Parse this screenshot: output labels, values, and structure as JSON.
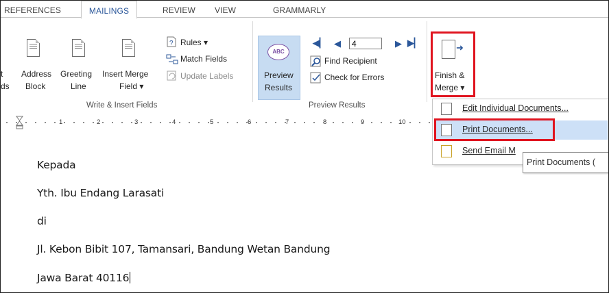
{
  "tabs": {
    "references": "REFERENCES",
    "mailings": "MAILINGS",
    "review": "REVIEW",
    "view": "VIEW",
    "grammarly": "GRAMMARLY"
  },
  "write_insert": {
    "partial_top": "t",
    "partial_bottom": "ds",
    "address_block": [
      "Address",
      "Block"
    ],
    "greeting_line": [
      "Greeting",
      "Line"
    ],
    "insert_merge_field": [
      "Insert Merge",
      "Field ▾"
    ],
    "rules": "Rules ▾",
    "match_fields": "Match Fields",
    "update_labels": "Update Labels",
    "group_label": "Write & Insert Fields"
  },
  "preview": {
    "preview_results": [
      "Preview",
      "Results"
    ],
    "record_number": "4",
    "find_recipient": "Find Recipient",
    "check_errors": "Check for Errors",
    "group_label": "Preview Results",
    "abc_glyph": "ABC"
  },
  "finish": {
    "label": [
      "Finish &",
      "Merge ▾"
    ]
  },
  "menu": {
    "edit_individual": "Edit Individual Documents...",
    "print_documents": "Print Documents...",
    "send_email": "Send Email M"
  },
  "tooltip": "Print Documents (",
  "ruler": [
    "1",
    "2",
    "3",
    "4",
    "5",
    "6",
    "7",
    "8",
    "9",
    "10"
  ],
  "document": {
    "lines": [
      "Kepada",
      "Yth. Ibu Endang Larasati",
      "di",
      "Jl. Kebon Bibit 107,  Tamansari, Bandung Wetan Bandung",
      "Jawa Barat 40116"
    ]
  },
  "colors": {
    "accent": "#2b579a",
    "highlight_box": "#e0141f",
    "menu_highlight": "#cde0f7",
    "preview_active": "#c7dcf2"
  }
}
